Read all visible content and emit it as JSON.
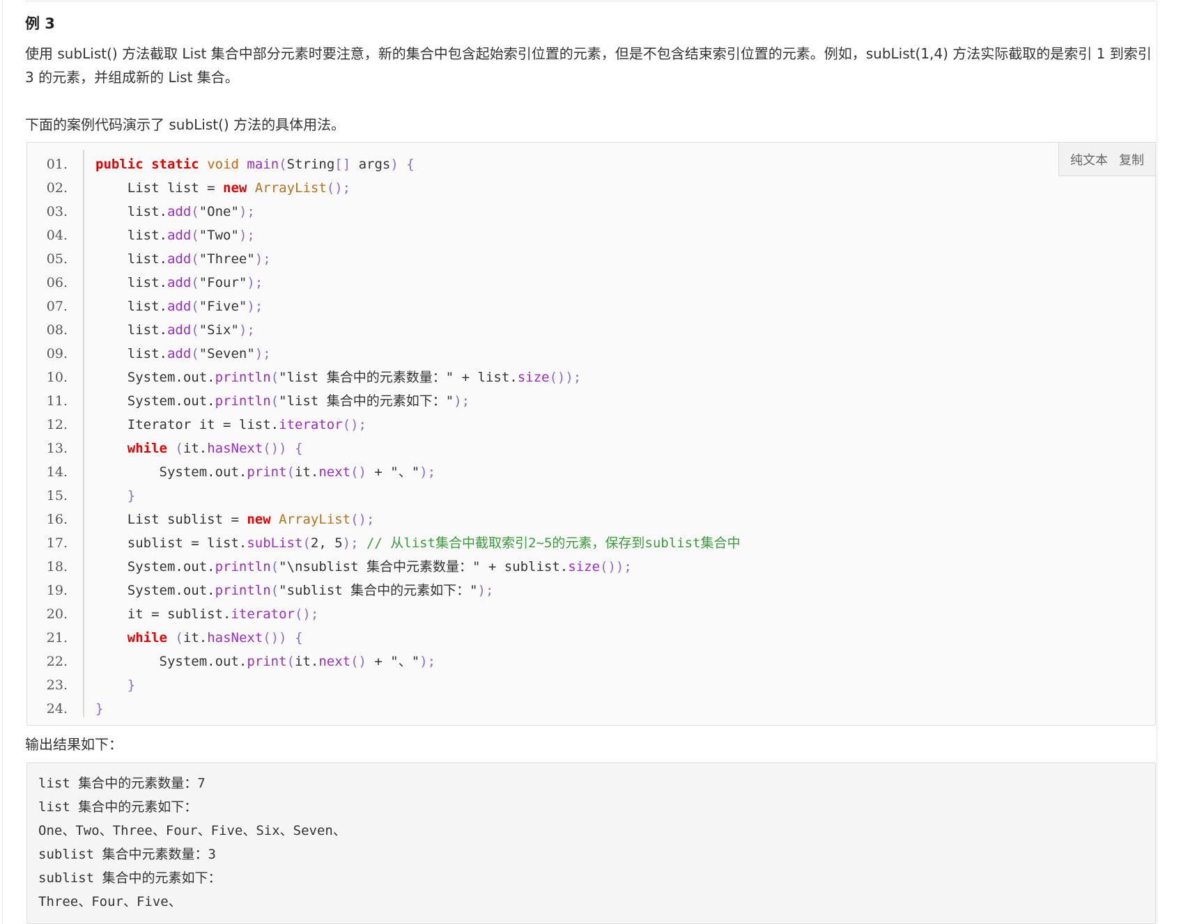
{
  "example_heading": "例 3",
  "intro_paragraph": "使用 subList() 方法截取 List 集合中部分元素时要注意，新的集合中包含起始索引位置的元素，但是不包含结束索引位置的元素。例如，subList(1,4) 方法实际截取的是索引 1 到索引 3 的元素，并组成新的 List 集合。",
  "code_intro": "下面的案例代码演示了 subList() 方法的具体用法。",
  "toolbar": {
    "plain_text_label": "纯文本",
    "copy_label": "复制"
  },
  "line_numbers": [
    "01.",
    "02.",
    "03.",
    "04.",
    "05.",
    "06.",
    "07.",
    "08.",
    "09.",
    "10.",
    "11.",
    "12.",
    "13.",
    "14.",
    "15.",
    "16.",
    "17.",
    "18.",
    "19.",
    "20.",
    "21.",
    "22.",
    "23.",
    "24."
  ],
  "output_label": "输出结果如下：",
  "output_lines": [
    "list 集合中的元素数量：7",
    "list 集合中的元素如下：",
    "One、Two、Three、Four、Five、Six、Seven、",
    "sublist 集合中元素数量：3",
    "sublist 集合中的元素如下：",
    "Three、Four、Five、"
  ],
  "colors": {
    "keyword": "#e30000",
    "type": "#c6690a",
    "method": "#9b2dc2",
    "comment": "#3c9a3c",
    "code_bg": "#fafafa"
  }
}
